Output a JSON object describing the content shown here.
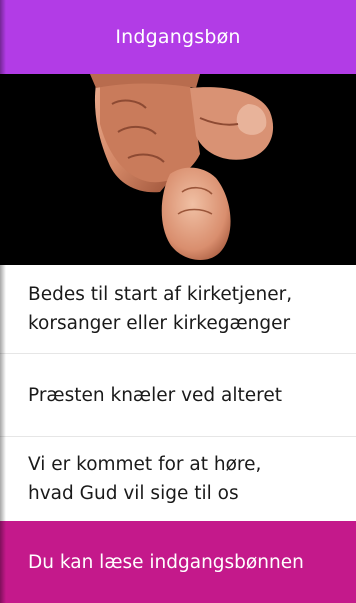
{
  "header": {
    "title": "Indgangsbøn"
  },
  "hero": {
    "image": "finger-pointing-at-viewer"
  },
  "items": [
    {
      "text": "Bedes til start af kirketjener,\nkorsanger eller kirkegænger"
    },
    {
      "text": "Præsten knæler ved alteret"
    },
    {
      "text": "Vi er kommet for at høre,\nhvad Gud vil sige til os"
    }
  ],
  "footer": {
    "text": "Du kan læse indgangsbønnen"
  },
  "colors": {
    "header": "#b23ce6",
    "footer": "#c4198b",
    "hero_bg": "#000000"
  }
}
